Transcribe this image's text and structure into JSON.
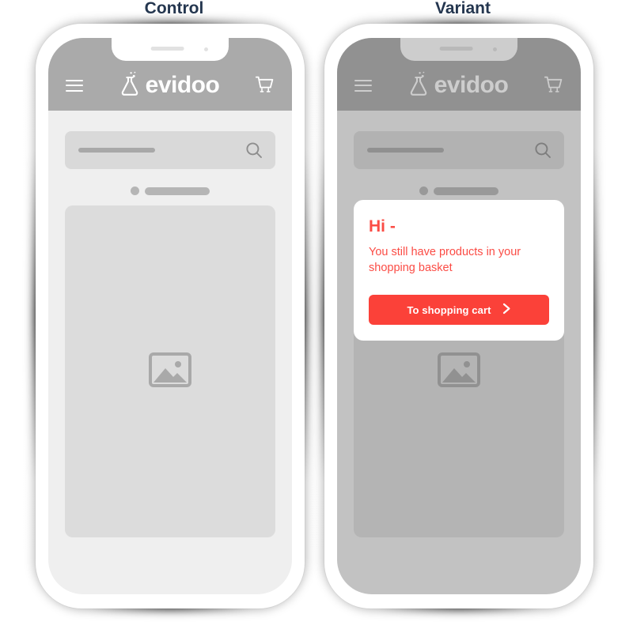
{
  "experiment": {
    "control_label": "Control",
    "variant_label": "Variant"
  },
  "brand": {
    "name": "evidoo",
    "logo_icon": "flask-icon",
    "logo_color": "#ffffff"
  },
  "header": {
    "menu_icon": "hamburger-menu-icon",
    "cart_icon": "shopping-cart-icon",
    "background_color": "#aaaaaa"
  },
  "search": {
    "icon": "search-icon",
    "placeholder": ""
  },
  "content": {
    "image_placeholder_icon": "image-placeholder-icon"
  },
  "modal": {
    "title": "Hi -",
    "body": "You still have products in your shopping basket",
    "cta_label": "To shopping cart",
    "cta_icon": "chevron-right-icon",
    "accent_color": "#fb4139",
    "text_color": "#fb4c45",
    "background_color": "#ffffff"
  },
  "colors": {
    "label_text": "#24364f",
    "screen_background": "#efefef",
    "search_background": "#d9d9d9",
    "hero_background": "#dcdcdc",
    "scrim": "rgba(90,90,90,0.30)"
  }
}
